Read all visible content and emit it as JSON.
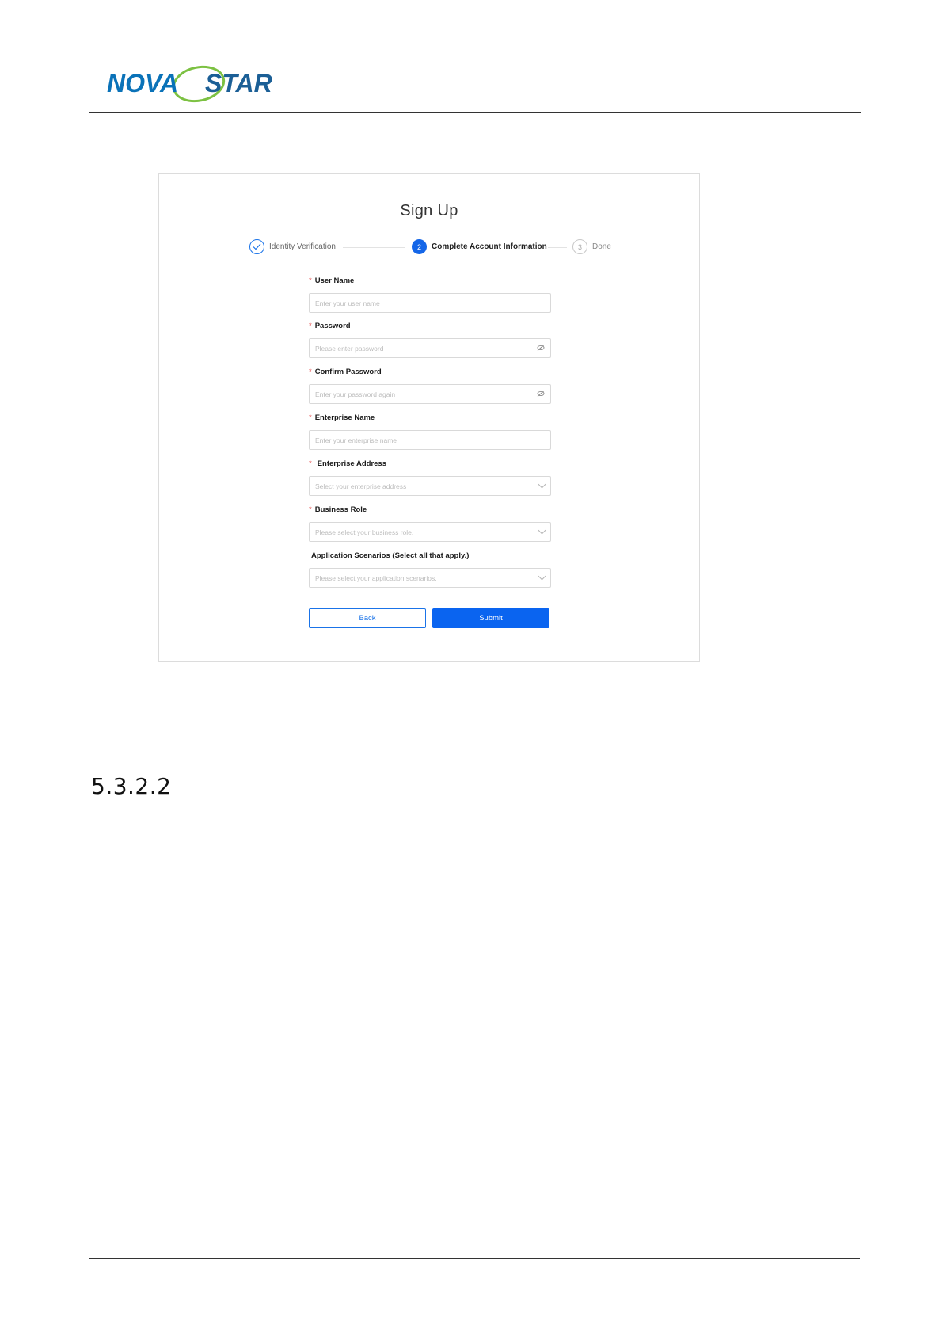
{
  "brand": {
    "logo_text_left": "NOVA",
    "logo_text_right": "STAR"
  },
  "signup": {
    "title": "Sign Up",
    "steps": [
      {
        "number": "1",
        "label": "Identity Verification",
        "state": "done"
      },
      {
        "number": "2",
        "label": "Complete Account Information",
        "state": "active"
      },
      {
        "number": "3",
        "label": "Done",
        "state": "todo"
      }
    ],
    "fields": [
      {
        "label": "User Name",
        "required": "*",
        "placeholder": "Enter your user name",
        "type": "text"
      },
      {
        "label": "Password",
        "required": "*",
        "placeholder": "Please enter password",
        "type": "password"
      },
      {
        "label": "Confirm Password",
        "required": "*",
        "placeholder": "Enter your password again",
        "type": "password"
      },
      {
        "label": "Enterprise Name",
        "required": "*",
        "placeholder": "Enter your enterprise name",
        "type": "text"
      },
      {
        "label": "Enterprise Address",
        "required": "*",
        "placeholder": "Select your enterprise address",
        "type": "select"
      },
      {
        "label": "Business Role",
        "required": "*",
        "placeholder": "Please select your business role.",
        "type": "select"
      },
      {
        "label": "Application Scenarios (Select all that apply.)",
        "required": "",
        "placeholder": "Please select your application scenarios.",
        "type": "select"
      }
    ],
    "back_label": "Back",
    "submit_label": "Submit"
  },
  "section": {
    "number": "5.3.2.2"
  },
  "colors": {
    "primary": "#0a64f0",
    "required": "#e23b3b",
    "logo_blue": "#0a72b8",
    "logo_green": "#7cc142"
  }
}
